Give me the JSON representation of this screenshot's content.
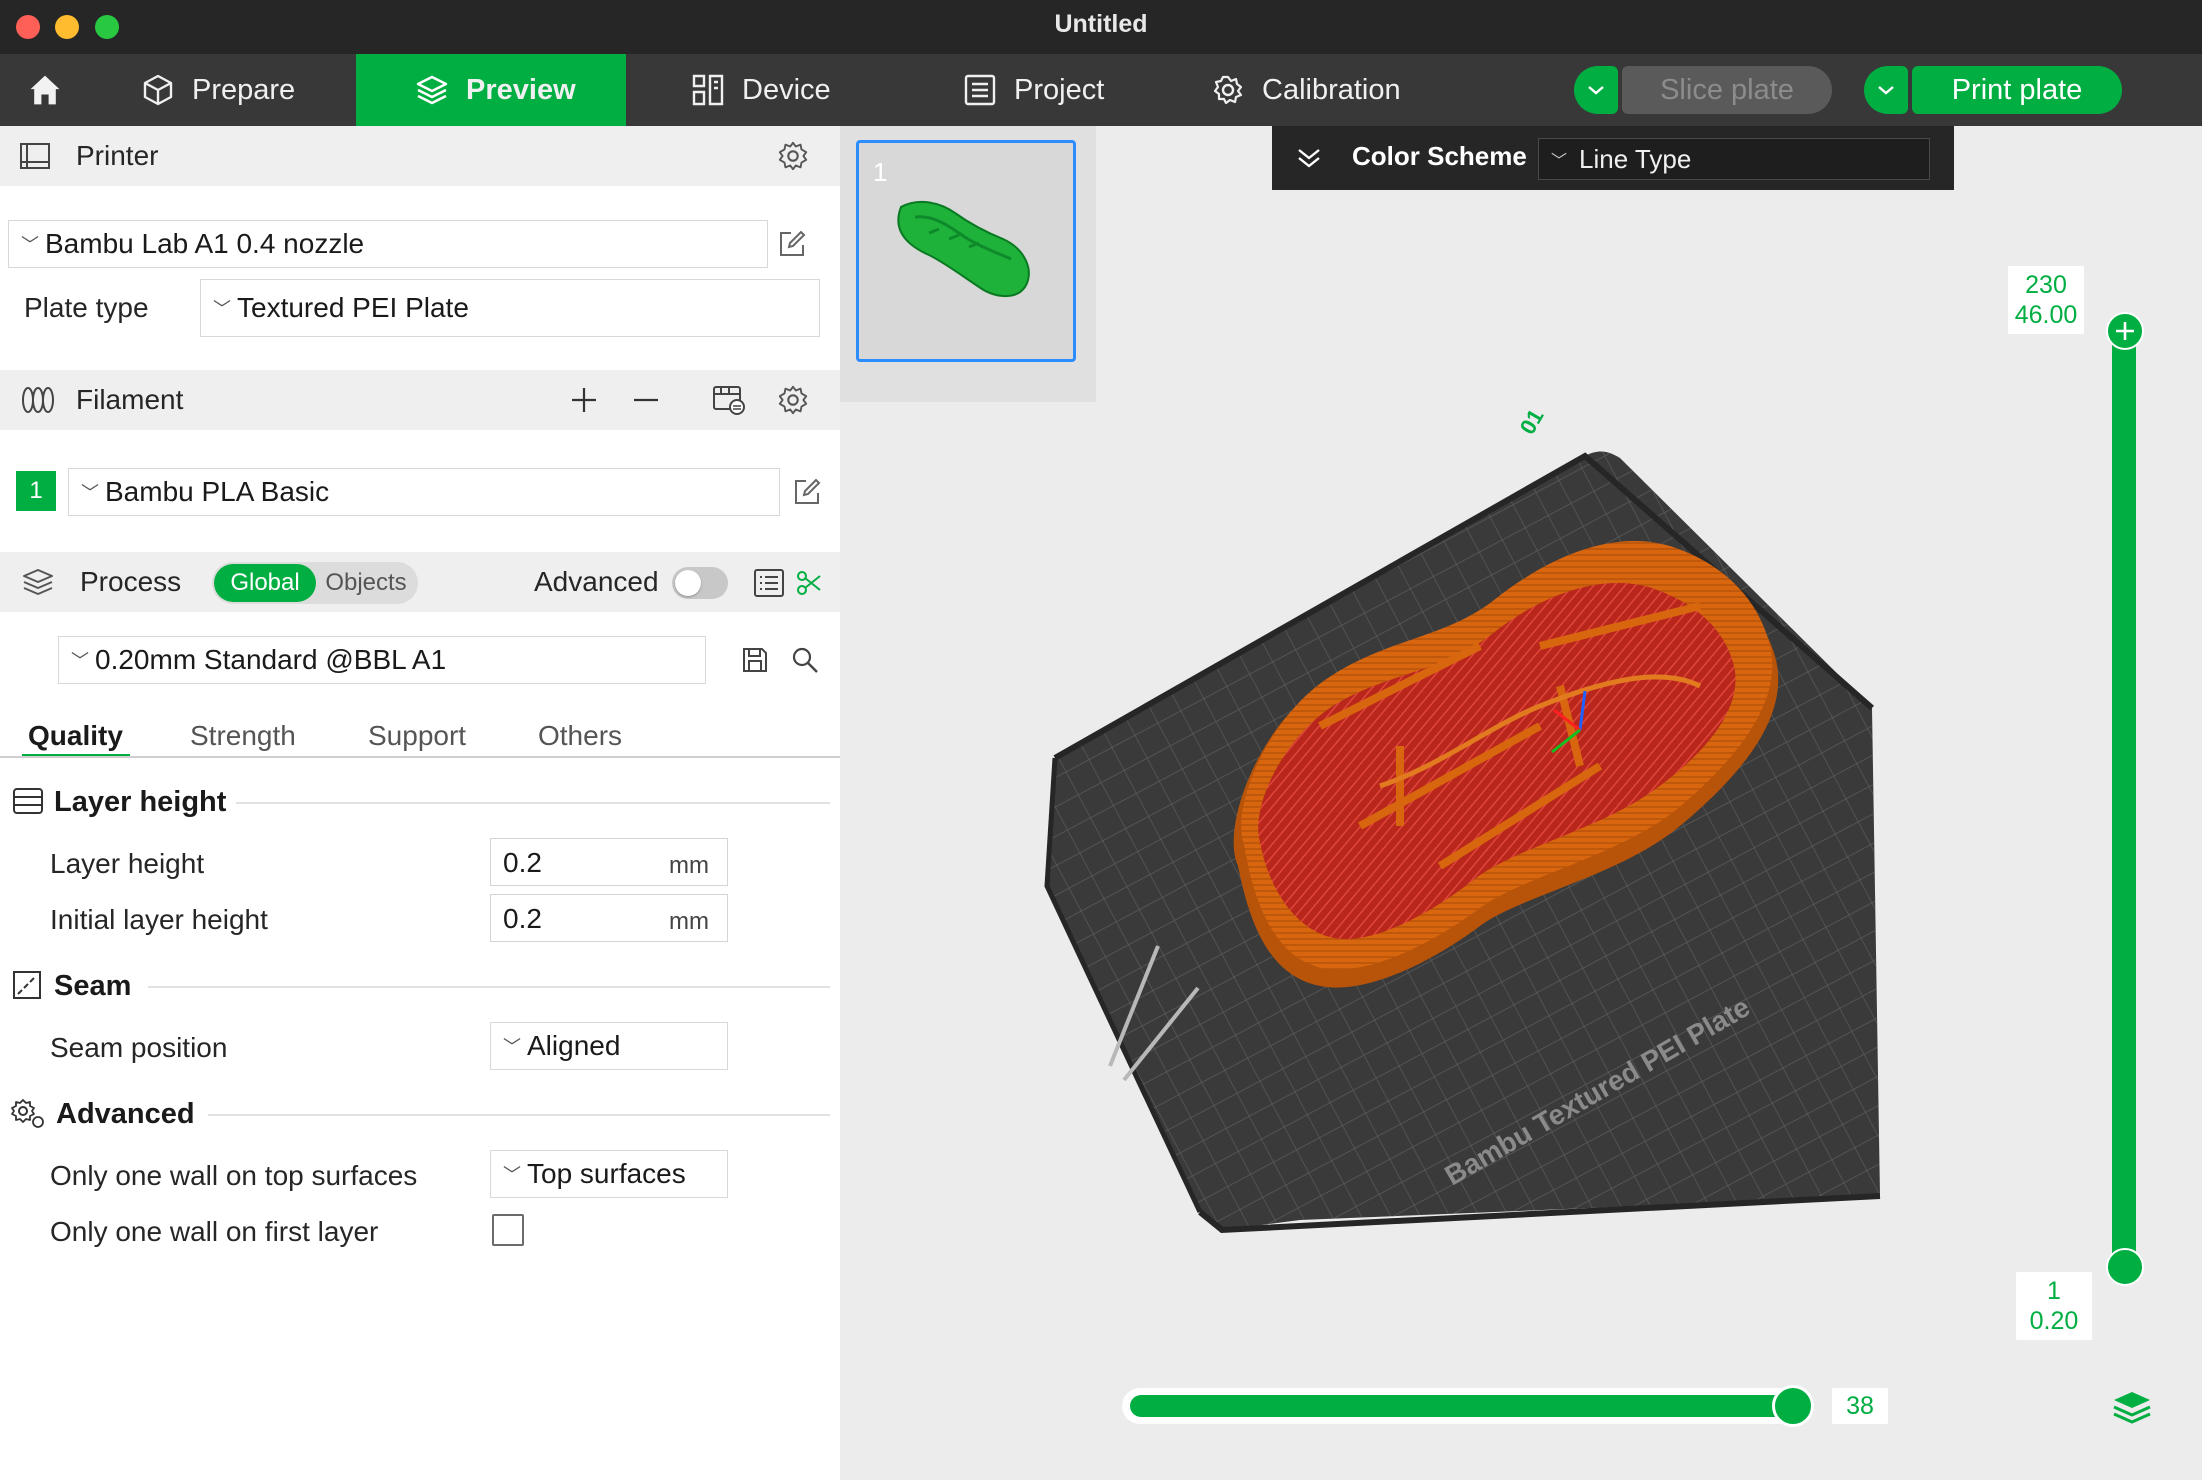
{
  "window": {
    "title": "Untitled"
  },
  "tabs": [
    {
      "label": "Prepare"
    },
    {
      "label": "Preview"
    },
    {
      "label": "Device"
    },
    {
      "label": "Project"
    },
    {
      "label": "Calibration"
    }
  ],
  "actions": {
    "slice_label": "Slice plate",
    "print_label": "Print plate"
  },
  "printer": {
    "section_title": "Printer",
    "selected": "Bambu Lab A1 0.4 nozzle",
    "plate_type_label": "Plate type",
    "plate_type": "Textured PEI Plate"
  },
  "filament": {
    "section_title": "Filament",
    "slot_number": "1",
    "slot_color": "#00ae42",
    "selected": "Bambu PLA Basic"
  },
  "process": {
    "section_title": "Process",
    "scope_global": "Global",
    "scope_objects": "Objects",
    "advanced_label": "Advanced",
    "advanced_on": false,
    "preset": "0.20mm Standard @BBL A1"
  },
  "settings_tabs": [
    {
      "label": "Quality",
      "active": true
    },
    {
      "label": "Strength",
      "active": false
    },
    {
      "label": "Support",
      "active": false
    },
    {
      "label": "Others",
      "active": false
    }
  ],
  "groups": {
    "layer_height": {
      "title": "Layer height",
      "layer_height_label": "Layer height",
      "layer_height_value": "0.2",
      "initial_layer_height_label": "Initial layer height",
      "initial_layer_height_value": "0.2",
      "unit": "mm"
    },
    "seam": {
      "title": "Seam",
      "seam_position_label": "Seam position",
      "seam_position_value": "Aligned"
    },
    "advanced": {
      "title": "Advanced",
      "one_wall_top_label": "Only one wall on top surfaces",
      "one_wall_top_value": "Top surfaces",
      "one_wall_first_label": "Only one wall on first layer",
      "one_wall_first_checked": false
    }
  },
  "viewport": {
    "plate_thumb_number": "1",
    "color_scheme_label": "Color Scheme",
    "color_scheme_value": "Line Type",
    "build_plate_text": "Bambu Textured PEI Plate",
    "plate_number_text": "01",
    "layer_top_number": "230",
    "layer_top_height": "46.00",
    "layer_bottom_number": "1",
    "layer_bottom_height": "0.20",
    "move_value": "38"
  },
  "colors": {
    "accent": "#00ae42",
    "titlebar": "#262626",
    "tabbar": "#383838",
    "selection": "#2c8dff",
    "model_orange": "#d8660f",
    "infill_red": "#c8261c"
  }
}
